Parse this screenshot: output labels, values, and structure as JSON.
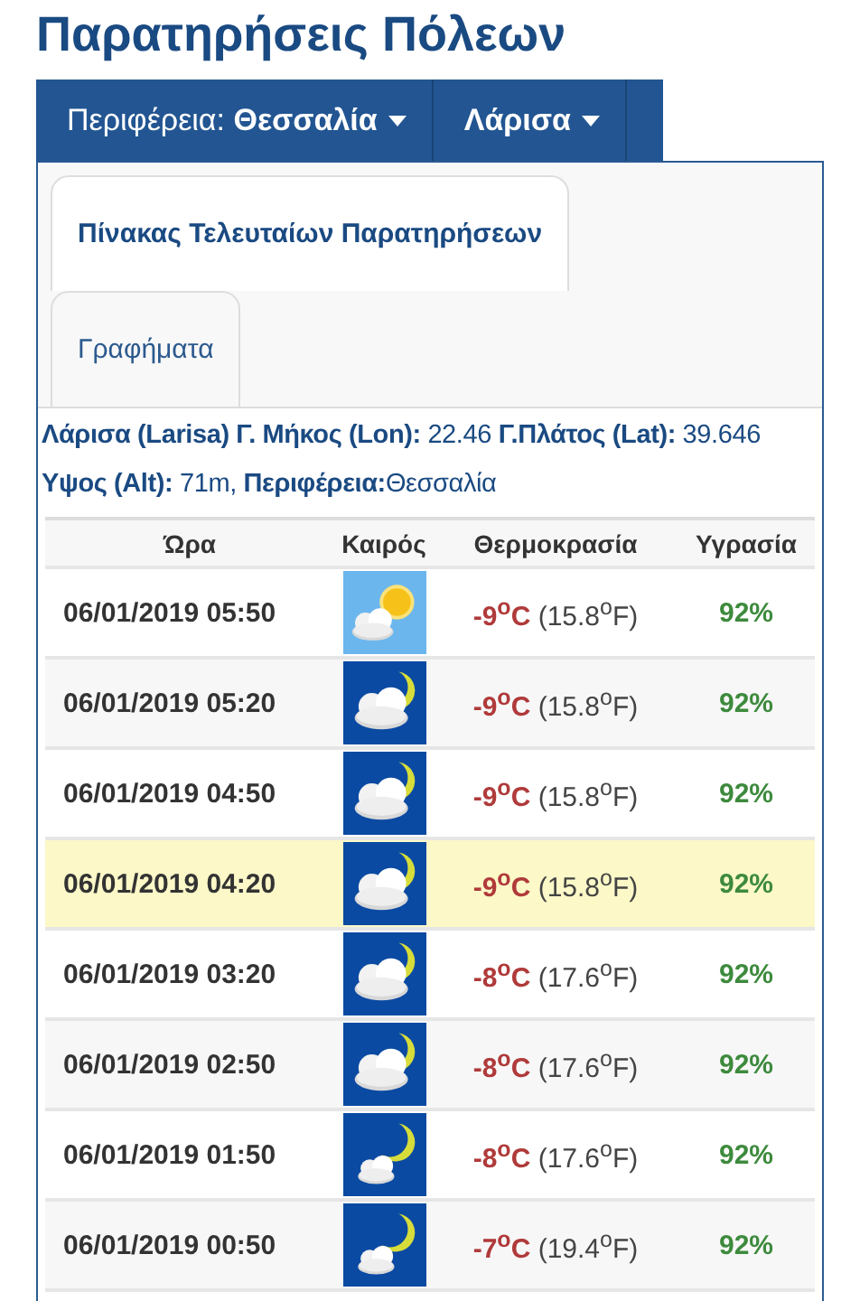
{
  "title": "Παρατηρήσεις Πόλεων",
  "nav": [
    {
      "label": "Περιφέρεια: **Θεσσαλία**"
    },
    {
      "label": "**Λάρισα**"
    }
  ],
  "tabs": [
    {
      "label": "Πίνακας Τελευταίων Παρατηρήσεων",
      "selected": true
    },
    {
      "label": "Γραφήματα",
      "selected": false
    }
  ],
  "info": [
    "**Λάρισα (Larisa) Γ. Μήκος (Lon):** 22.46 **Γ.Πλάτος (Lat):** 39.646",
    "**Υψος (Alt):** 71m, **Περιφέρεια:**Θεσσαλία"
  ],
  "table": {
    "columns": [
      "Ώρα",
      "Καιρός",
      "Θερμοκρασία",
      "Υγρασία"
    ],
    "rows": [
      {
        "time": "06/01/2019 05:50",
        "kind": "sun-cloud",
        "temp_c": "-9$^{o}$C",
        "temp_f": "(15.8$^{o}$F)",
        "humidity": "92%",
        "selected": false
      },
      {
        "time": "06/01/2019 05:20",
        "kind": "moon-cloud",
        "temp_c": "-9$^{o}$C",
        "temp_f": "(15.8$^{o}$F)",
        "humidity": "92%",
        "selected": false
      },
      {
        "time": "06/01/2019 04:50",
        "kind": "moon-cloud",
        "temp_c": "-9$^{o}$C",
        "temp_f": "(15.8$^{o}$F)",
        "humidity": "92%",
        "selected": false
      },
      {
        "time": "06/01/2019 04:20",
        "kind": "moon-cloud",
        "temp_c": "-9$^{o}$C",
        "temp_f": "(15.8$^{o}$F)",
        "humidity": "92%",
        "selected": true
      },
      {
        "time": "06/01/2019 03:20",
        "kind": "moon-cloud",
        "temp_c": "-8$^{o}$C",
        "temp_f": "(17.6$^{o}$F)",
        "humidity": "92%",
        "selected": false
      },
      {
        "time": "06/01/2019 02:50",
        "kind": "moon-cloud",
        "temp_c": "-8$^{o}$C",
        "temp_f": "(17.6$^{o}$F)",
        "humidity": "92%",
        "selected": false
      },
      {
        "time": "06/01/2019 01:50",
        "kind": "moon-small-cloud",
        "temp_c": "-8$^{o}$C",
        "temp_f": "(17.6$^{o}$F)",
        "humidity": "92%",
        "selected": false
      },
      {
        "time": "06/01/2019 00:50",
        "kind": "moon-small-cloud",
        "temp_c": "-7$^{o}$C",
        "temp_f": "(19.4$^{o}$F)",
        "humidity": "92%",
        "selected": false
      }
    ]
  }
}
